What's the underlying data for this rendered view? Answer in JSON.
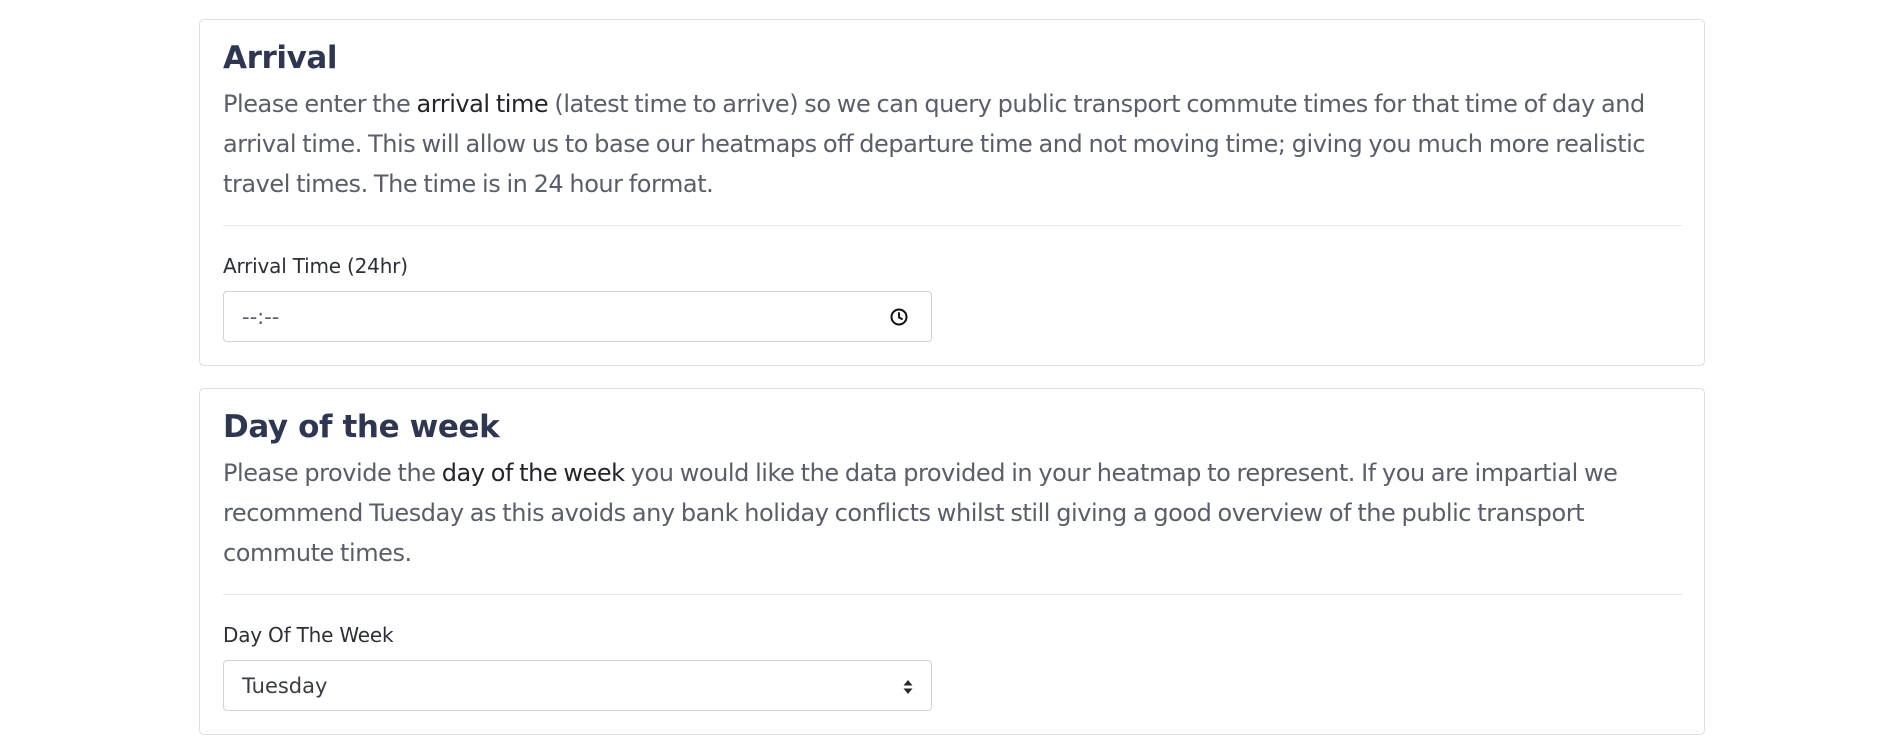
{
  "arrival": {
    "title": "Arrival",
    "desc_pre": "Please enter the ",
    "desc_strong": "arrival time",
    "desc_post": " (latest time to arrive) so we can query public transport commute times for that time of day and arrival time. This will allow us to base our heatmaps off departure time and not moving time; giving you much more realistic travel times. The time is in 24 hour format.",
    "field_label": "Arrival Time (24hr)",
    "input_placeholder": "--:--",
    "icon": "clock-icon"
  },
  "day_of_week": {
    "title": "Day of the week",
    "desc_pre": "Please provide the ",
    "desc_strong": "day of the week",
    "desc_post": " you would like the data provided in your heatmap to represent. If you are impartial we recommend Tuesday as this avoids any bank holiday conflicts whilst still giving a good overview of the public transport commute times.",
    "field_label": "Day Of The Week",
    "selected_value": "Tuesday",
    "icon": "select-arrows-icon"
  },
  "colors": {
    "title": "#2e3653",
    "body_text": "#5a5e69",
    "emphasis": "#23252b",
    "border": "#dcdfe3"
  }
}
